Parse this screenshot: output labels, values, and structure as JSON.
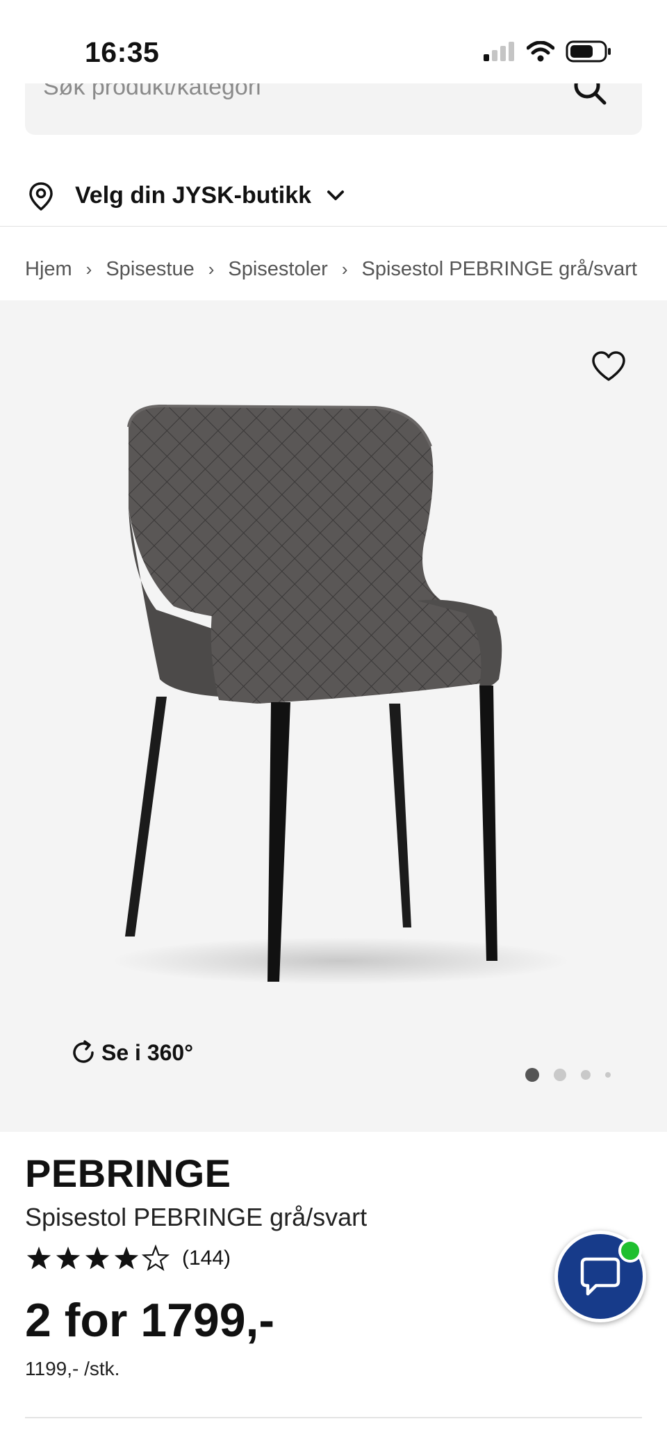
{
  "status_bar": {
    "time": "16:35"
  },
  "search": {
    "placeholder": "Søk produkt/kategori"
  },
  "store": {
    "label": "Velg din JYSK-butikk"
  },
  "breadcrumb": [
    {
      "label": "Hjem"
    },
    {
      "label": "Spisestue"
    },
    {
      "label": "Spisestoler"
    },
    {
      "label": "Spisestol PEBRINGE grå/svart"
    }
  ],
  "gallery": {
    "view360_label": "Se i 360°",
    "active_index": 0,
    "dot_count": 4
  },
  "product": {
    "brand": "PEBRINGE",
    "name": "Spisestol PEBRINGE grå/svart",
    "rating_stars": 4,
    "rating_max": 5,
    "review_count": "(144)",
    "offer": "2 for 1799,-",
    "unit_price": "1199,- /stk."
  },
  "colors": {
    "chat_button": "#173b8a",
    "online_badge": "#1fbf2f",
    "gallery_bg": "#f4f4f4"
  },
  "icons": [
    "search-icon",
    "location-pin-icon",
    "chevron-down-icon",
    "heart-icon",
    "rotate-360-icon",
    "star-icon",
    "chat-icon"
  ]
}
